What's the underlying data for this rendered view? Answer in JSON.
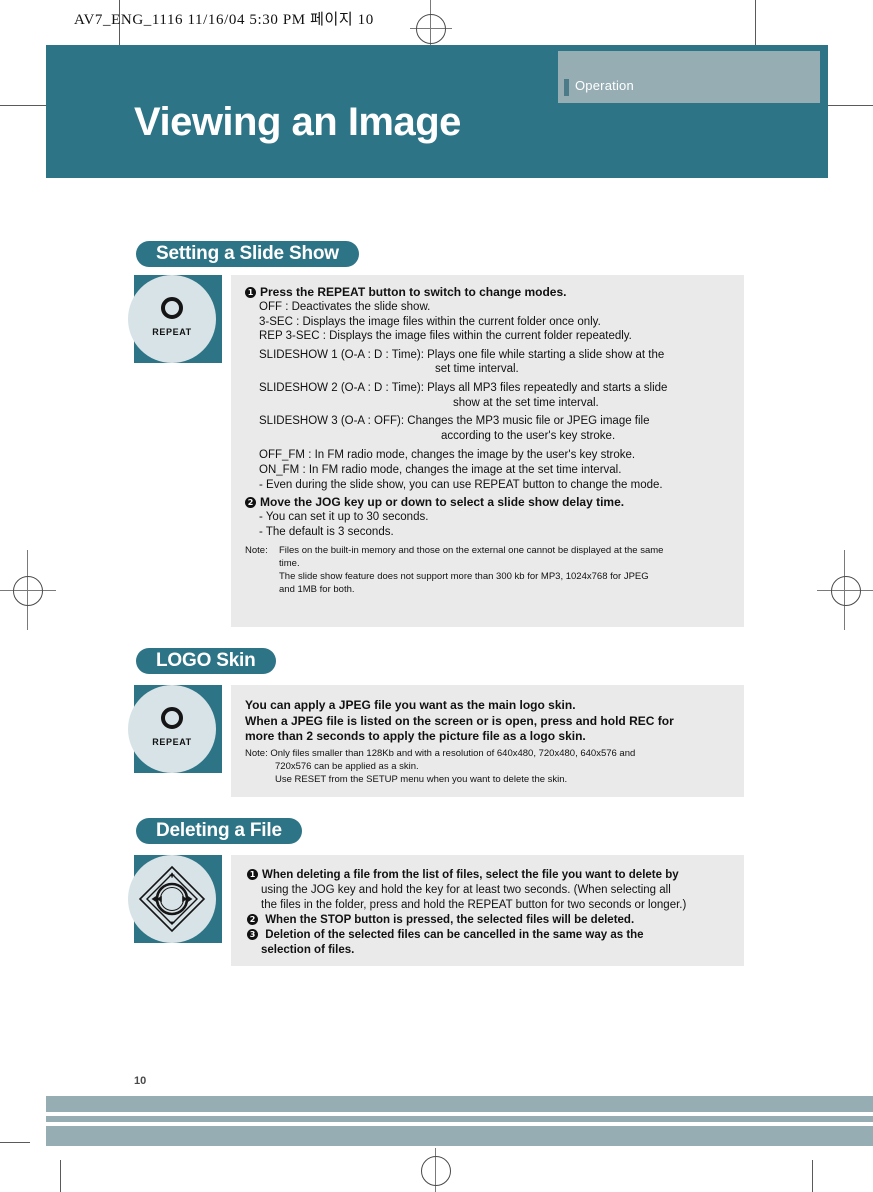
{
  "page": {
    "filestamp": "AV7_ENG_1116  11/16/04  5:30 PM  페이지 10",
    "page_number": "10",
    "colors": {
      "teal": "#2d7486",
      "tab_gray_blue": "#96adb4",
      "panel_gray": "#eaeaea",
      "icon_circle": "#d8e3e7"
    }
  },
  "header": {
    "tab_label": "Operation",
    "title": "Viewing an Image"
  },
  "sections": {
    "slideshow": {
      "heading": "Setting a Slide Show",
      "icon_label": "REPEAT",
      "step1": "Press the REPEAT button to switch to change modes.",
      "modes": [
        {
          "name": "OFF :",
          "desc": "Deactivates the slide show."
        },
        {
          "name": "3-SEC :",
          "desc": "Displays the image files within the current folder once only."
        },
        {
          "name": "REP 3-SEC :",
          "desc": "Displays the image files within the current folder repeatedly."
        }
      ],
      "slideshow1_name": "SLIDESHOW 1",
      "slideshow1_params": "(O-A : D : Time)",
      "slideshow1_colon": ":",
      "slideshow1_desc": "Plays one file while starting a slide show at the",
      "slideshow1_desc2": "set time interval.",
      "slideshow2_name": "SLIDESHOW 2",
      "slideshow2_params": "(O-A : D : Time)",
      "slideshow2_colon": ":",
      "slideshow2_desc": "Plays all MP3 files repeatedly and starts a slide",
      "slideshow2_desc2": "show at the set time interval.",
      "slideshow3_name": "SLIDESHOW 3",
      "slideshow3_params": "(O-A : OFF):",
      "slideshow3_desc": "Changes the MP3 music file or JPEG image file",
      "slideshow3_desc2": "according to the user's key stroke.",
      "fm_modes": [
        {
          "name": "OFF_FM :",
          "desc": "In FM radio mode, changes the image by the user's key stroke."
        },
        {
          "name": "ON_FM :",
          "desc": "In FM radio mode, changes the image at the set time interval."
        }
      ],
      "dash1": "- Even during the slide show, you can use REPEAT button to change the mode.",
      "step2": "Move the JOG key up or down to select a slide show delay time.",
      "dash2": "- You can set it up to 30 seconds.",
      "dash3": "-  The default is 3 seconds.",
      "note_label": "Note:",
      "note_line1": "Files on the built-in memory and those on the external one cannot be displayed at the same",
      "note_line2": "time.",
      "note_line3": "The slide show feature does not support more than 300 kb for MP3, 1024x768 for JPEG",
      "note_line4": "and 1MB for both."
    },
    "logo_skin": {
      "heading": "LOGO Skin",
      "icon_label": "REPEAT",
      "line1": "You can apply a JPEG file you want as the main logo skin.",
      "line2": "When a JPEG file is listed on the screen or is open, press and hold REC for",
      "line3": "more than 2 seconds to apply the picture file as a logo skin.",
      "note1": "Note: Only files smaller than 128Kb and with a resolution of 640x480, 720x480, 640x576 and",
      "note2": "720x576 can be applied as a skin.",
      "note3": "Use RESET from the SETUP menu when you want to delete the skin."
    },
    "deleting": {
      "heading": "Deleting a File",
      "icon_label": "jog-key",
      "step1a": "When deleting a file from the list of files, select the file you want to delete by",
      "step1b": "using the JOG key and hold the key for at least two seconds.",
      "step1c": "(When selecting all",
      "step1d": "the files in the folder, press and hold the REPEAT button for two seconds or longer.)",
      "step2": "When the STOP button is pressed, the selected files will be deleted.",
      "step3a": "Deletion of the selected files can be cancelled in the same way as the",
      "step3b": "selection of files."
    }
  }
}
